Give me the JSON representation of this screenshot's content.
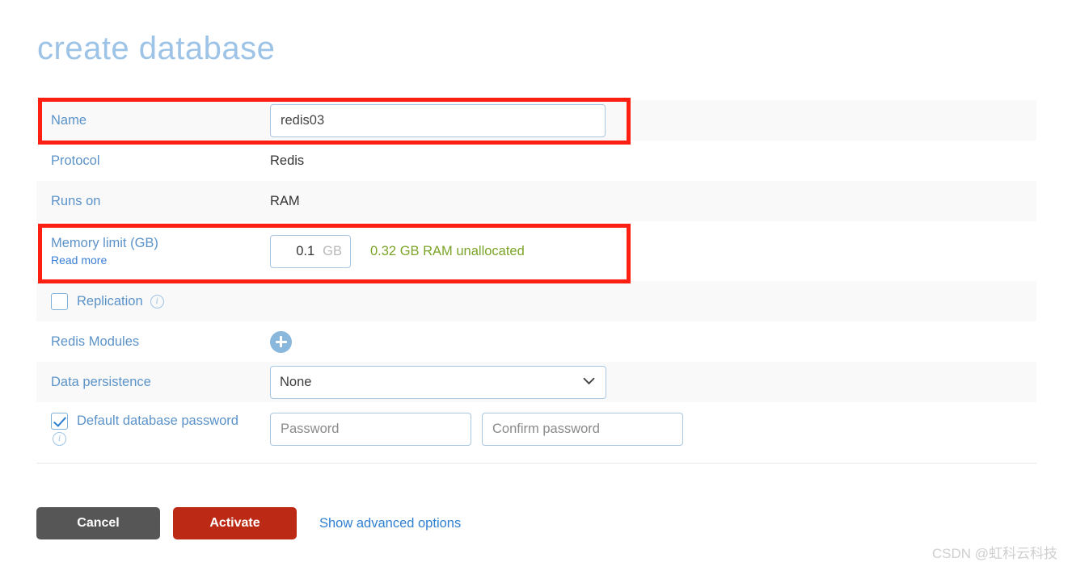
{
  "page": {
    "title": "create database"
  },
  "form": {
    "rows": [
      {
        "label": "Name",
        "value": "redis03"
      },
      {
        "label": "Protocol",
        "value": "Redis"
      },
      {
        "label": "Runs on",
        "value": "RAM"
      },
      {
        "label": "Memory limit (GB)",
        "sub_link": "Read more"
      },
      {
        "label": "Replication"
      },
      {
        "label": "Redis Modules"
      },
      {
        "label": "Data persistence",
        "value": "None"
      },
      {
        "label": "Default database password"
      }
    ]
  },
  "fields": {
    "name_input_value": "redis03",
    "protocol_value": "Redis",
    "runs_on_value": "RAM",
    "memory_label": "Memory limit (GB)",
    "memory_read_more": "Read more",
    "memory_value": "0.1",
    "memory_unit": "GB",
    "memory_note": "0.32 GB RAM unallocated",
    "replication_label": "Replication",
    "replication_checked": false,
    "redis_modules_label": "Redis Modules",
    "add_module_icon": "plus-circle-icon",
    "data_persistence_label": "Data persistence",
    "data_persistence_value": "None",
    "data_persistence_options": [
      "None"
    ],
    "password_checkbox_label": "Default database password",
    "password_checked": true,
    "password_placeholder": "Password",
    "confirm_password_placeholder": "Confirm password",
    "info_icon": "info-circle-icon",
    "chevron_icon": "chevron-down-icon"
  },
  "actions": {
    "cancel_label": "Cancel",
    "activate_label": "Activate",
    "advanced_label": "Show advanced options"
  },
  "watermark": {
    "text": "CSDN @虹科云科技"
  },
  "colors": {
    "title": "#9dc3e6",
    "label": "#5b93c9",
    "link": "#2f7fd1",
    "note_green": "#7ba428",
    "activate_red": "#bc2a16",
    "cancel_grey": "#565656",
    "annotation_red": "#fc1f12",
    "row_stripe": "#f9f9f9"
  }
}
